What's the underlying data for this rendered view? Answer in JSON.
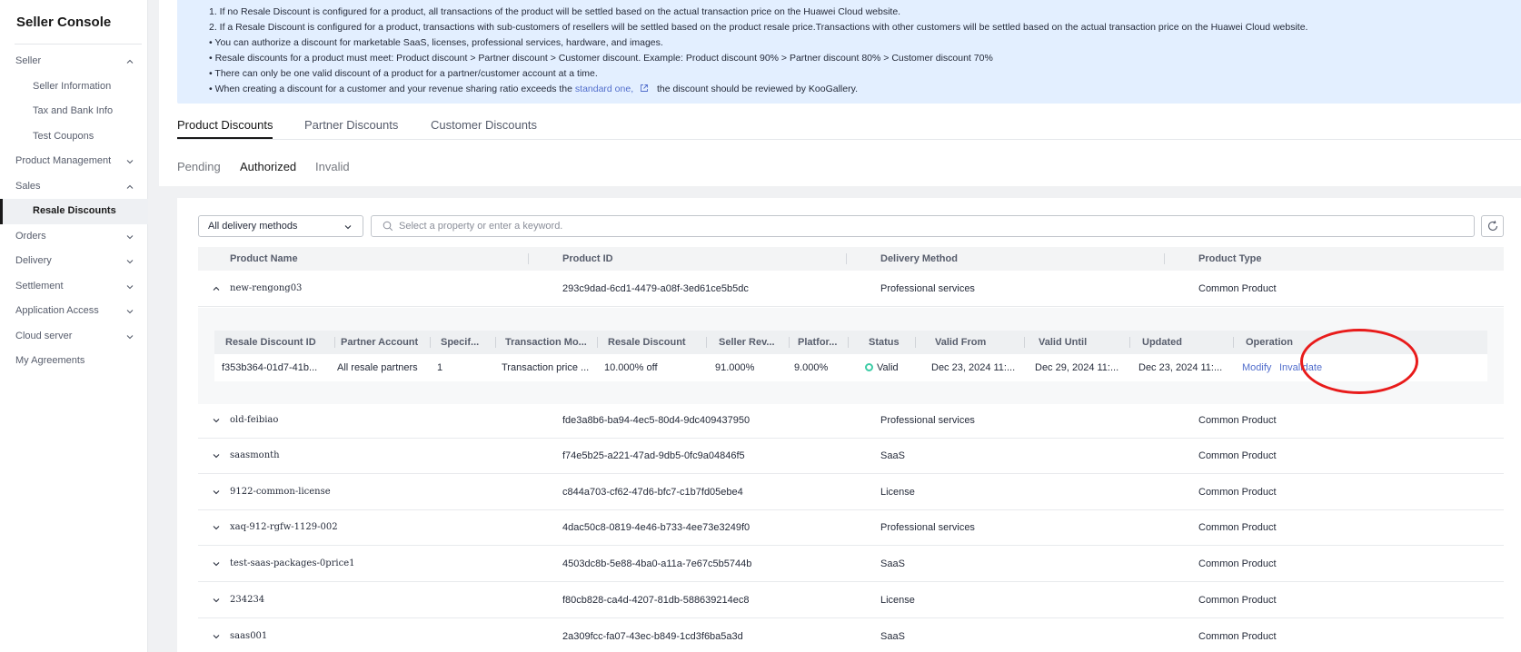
{
  "sidebar": {
    "title": "Seller Console",
    "items": [
      {
        "label": "Seller",
        "chevron": "up"
      },
      {
        "label": "Seller Information"
      },
      {
        "label": "Tax and Bank Info"
      },
      {
        "label": "Test Coupons"
      },
      {
        "label": "Product Management",
        "chevron": "down"
      },
      {
        "label": "Sales",
        "chevron": "up"
      },
      {
        "label": "Resale Discounts"
      },
      {
        "label": "Orders",
        "chevron": "down"
      },
      {
        "label": "Delivery",
        "chevron": "down"
      },
      {
        "label": "Settlement",
        "chevron": "down"
      },
      {
        "label": "Application Access",
        "chevron": "down"
      },
      {
        "label": "Cloud server",
        "chevron": "down"
      },
      {
        "label": "My Agreements"
      }
    ]
  },
  "notice": {
    "line1": "1. If no Resale Discount is configured for a product, all transactions of the product will be settled based on the actual transaction price on the Huawei Cloud website.",
    "line2": "2. If a Resale Discount is configured for a product, transactions with sub-customers of resellers will be settled based on the product resale price.Transactions with other customers will be settled based on the actual transaction price on the Huawei Cloud website.",
    "line3": "• You can authorize a discount for marketable SaaS, licenses, professional services, hardware, and images.",
    "line4": "• Resale discounts for a product must meet: Product discount > Partner discount > Customer discount. Example: Product discount 90% > Partner discount 80% > Customer discount 70%",
    "line5": "• There can only be one valid discount of a product for a partner/customer account at a time.",
    "line6_pre": "• When creating a discount for a customer and your revenue sharing ratio exceeds the",
    "line6_link": "standard one,",
    "line6_post": "the discount should be reviewed by KooGallery."
  },
  "tabs": {
    "product": "Product Discounts",
    "partner": "Partner Discounts",
    "customer": "Customer Discounts"
  },
  "subtabs": {
    "pending": "Pending",
    "authorized": "Authorized",
    "invalid": "Invalid"
  },
  "filter": {
    "delivery_select": "All delivery methods",
    "search_placeholder": "Select a property or enter a keyword."
  },
  "table": {
    "headers": {
      "name": "Product Name",
      "id": "Product ID",
      "method": "Delivery Method",
      "type": "Product Type"
    },
    "rows": [
      {
        "name": "new-rengong03",
        "id": "293c9dad-6cd1-4479-a08f-3ed61ce5b5dc",
        "method": "Professional services",
        "type": "Common Product"
      },
      {
        "name": "old-feibiao",
        "id": "fde3a8b6-ba94-4ec5-80d4-9dc409437950",
        "method": "Professional services",
        "type": "Common Product"
      },
      {
        "name": "saasmonth",
        "id": "f74e5b25-a221-47ad-9db5-0fc9a04846f5",
        "method": "SaaS",
        "type": "Common Product"
      },
      {
        "name": "9122-common-license",
        "id": "c844a703-cf62-47d6-bfc7-c1b7fd05ebe4",
        "method": "License",
        "type": "Common Product"
      },
      {
        "name": "xaq-912-rgfw-1129-002",
        "id": "4dac50c8-0819-4e46-b733-4ee73e3249f0",
        "method": "Professional services",
        "type": "Common Product"
      },
      {
        "name": "test-saas-packages-0price1",
        "id": "4503dc8b-5e88-4ba0-a11a-7e67c5b5744b",
        "method": "SaaS",
        "type": "Common Product"
      },
      {
        "name": "234234",
        "id": "f80cb828-ca4d-4207-81db-588639214ec8",
        "method": "License",
        "type": "Common Product"
      },
      {
        "name": "saas001",
        "id": "2a309fcc-fa07-43ec-b849-1cd3f6ba5a3d",
        "method": "SaaS",
        "type": "Common Product"
      }
    ]
  },
  "detail": {
    "headers": {
      "discount_id": "Resale Discount ID",
      "partner": "Partner Account",
      "spec": "Specif...",
      "txn_mode": "Transaction Mo...",
      "resale_discount": "Resale Discount",
      "seller_rev": "Seller Rev...",
      "platform": "Platfor...",
      "status": "Status",
      "valid_from": "Valid From",
      "valid_until": "Valid Until",
      "updated": "Updated",
      "operation": "Operation"
    },
    "row": {
      "discount_id": "f353b364-01d7-41b...",
      "partner": "All resale partners",
      "spec": "1",
      "txn_mode": "Transaction price ...",
      "resale_discount": "10.000% off",
      "seller_rev": "91.000%",
      "platform": "9.000%",
      "status": "Valid",
      "valid_from": "Dec 23, 2024 11:...",
      "valid_until": "Dec 29, 2024 11:...",
      "updated": "Dec 23, 2024 11:...",
      "op_modify": "Modify",
      "op_invalidate": "Invalidate"
    }
  },
  "colors": {
    "link": "#526ecc",
    "status_valid": "#3dcca6",
    "annotation": "#e81b1b",
    "notice_bg": "#e3efff"
  }
}
